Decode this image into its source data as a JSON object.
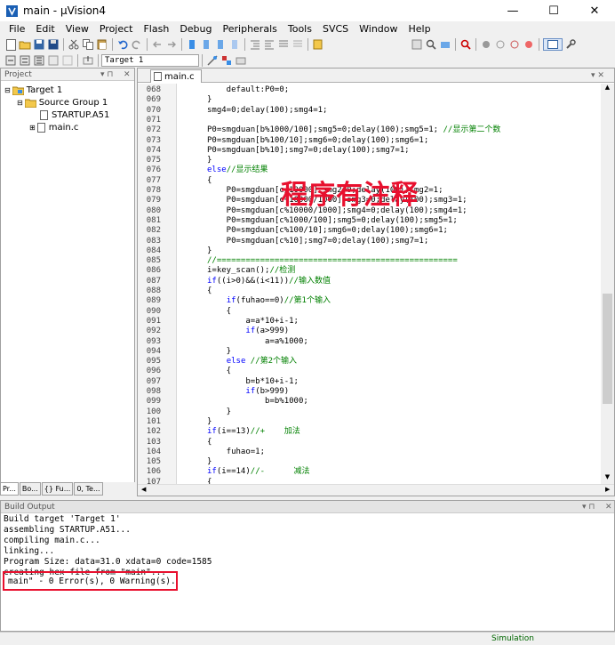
{
  "window": {
    "title": "main - µVision4",
    "minimize": "—",
    "maximize": "☐",
    "close": "✕"
  },
  "menu": [
    {
      "label": "File",
      "u": "F",
      "rest": "ile"
    },
    {
      "label": "Edit",
      "u": "E",
      "rest": "dit"
    },
    {
      "label": "View",
      "u": "V",
      "rest": "iew"
    },
    {
      "label": "Project",
      "u": "P",
      "rest": "roject"
    },
    {
      "label": "Flash",
      "u": "l",
      "pre": "F",
      "rest": "ash"
    },
    {
      "label": "Debug",
      "u": "D",
      "rest": "ebug"
    },
    {
      "label": "Peripherals",
      "u": "k",
      "pre": "Peripherals",
      "rest": ""
    },
    {
      "label": "Tools",
      "u": "T",
      "rest": "ools"
    },
    {
      "label": "SVCS",
      "u": "S",
      "rest": "VCS"
    },
    {
      "label": "Window",
      "u": "W",
      "rest": "indow"
    },
    {
      "label": "Help",
      "u": "H",
      "rest": "elp"
    }
  ],
  "toolbar": {
    "target_select": "Target 1"
  },
  "project": {
    "header": "Project",
    "tree": {
      "target": "Target 1",
      "group": "Source Group 1",
      "file_asm": "STARTUP.A51",
      "file_c": "main.c"
    },
    "tabs": [
      "Pr...",
      "Bo...",
      "{} Fu...",
      "0, Te..."
    ]
  },
  "editor": {
    "tab": "main.c",
    "watermark": "程序有注释",
    "lines": [
      {
        "n": "068",
        "code": "    default:P0=0;"
      },
      {
        "n": "069",
        "code": "}"
      },
      {
        "n": "070",
        "code": "smg4=0;delay(100);smg4=1;"
      },
      {
        "n": "071",
        "code": ""
      },
      {
        "n": "072",
        "code": "P0=smgduan[b%1000/100];smg5=0;delay(100);smg5=1; ",
        "comment": "//显示第二个数"
      },
      {
        "n": "073",
        "code": "P0=smgduan[b%100/10];smg6=0;delay(100);smg6=1;"
      },
      {
        "n": "074",
        "code": "P0=smgduan[b%10];smg7=0;delay(100);smg7=1;"
      },
      {
        "n": "075",
        "code": "}"
      },
      {
        "n": "076",
        "kw": "else",
        "comment": "//显示结果"
      },
      {
        "n": "077",
        "code": "{"
      },
      {
        "n": "078",
        "code": "    P0=smgduan[c/10000];smg2=0;delay(100);smg2=1;"
      },
      {
        "n": "079",
        "code": "    P0=smgduan[c%10000/1000];smg3=0;delay(100);smg3=1;"
      },
      {
        "n": "080",
        "code": "    P0=smgduan[c%10000/1000];smg4=0;delay(100);smg4=1;"
      },
      {
        "n": "081",
        "code": "    P0=smgduan[c%1000/100];smg5=0;delay(100);smg5=1;"
      },
      {
        "n": "082",
        "code": "    P0=smgduan[c%100/10];smg6=0;delay(100);smg6=1;"
      },
      {
        "n": "083",
        "code": "    P0=smgduan[c%10];smg7=0;delay(100);smg7=1;"
      },
      {
        "n": "084",
        "code": "}"
      },
      {
        "n": "085",
        "comment": "//=================================================="
      },
      {
        "n": "086",
        "code": "i=key_scan();",
        "comment": "//检测"
      },
      {
        "n": "087",
        "kw": "if",
        "code": "((i>0)&&(i<11))",
        "comment": "//输入数值"
      },
      {
        "n": "088",
        "code": "{"
      },
      {
        "n": "089",
        "pre": "    ",
        "kw": "if",
        "code": "(fuhao==0)",
        "comment": "//第1个输入"
      },
      {
        "n": "090",
        "code": "    {"
      },
      {
        "n": "091",
        "code": "        a=a*10+i-1;"
      },
      {
        "n": "092",
        "pre": "        ",
        "kw": "if",
        "code": "(a>999)"
      },
      {
        "n": "093",
        "code": "            a=a%1000;"
      },
      {
        "n": "094",
        "code": "    }"
      },
      {
        "n": "095",
        "pre": "    ",
        "kw": "else",
        "code": " ",
        "comment": "//第2个输入"
      },
      {
        "n": "096",
        "code": "    {"
      },
      {
        "n": "097",
        "code": "        b=b*10+i-1;"
      },
      {
        "n": "098",
        "pre": "        ",
        "kw": "if",
        "code": "(b>999)"
      },
      {
        "n": "099",
        "code": "            b=b%1000;"
      },
      {
        "n": "100",
        "code": "    }"
      },
      {
        "n": "101",
        "code": "}"
      },
      {
        "n": "102",
        "kw": "if",
        "code": "(i==13)",
        "comment": "//+    加法"
      },
      {
        "n": "103",
        "code": "{"
      },
      {
        "n": "104",
        "code": "    fuhao=1;"
      },
      {
        "n": "105",
        "code": "}"
      },
      {
        "n": "106",
        "kw": "if",
        "code": "(i==14)",
        "comment": "//-      减法"
      },
      {
        "n": "107",
        "code": "{"
      }
    ]
  },
  "build": {
    "header": "Build Output",
    "lines": [
      "Build target 'Target 1'",
      "assembling STARTUP.A51...",
      "compiling main.c...",
      "linking...",
      "Program Size: data=31.0 xdata=0 code=1585",
      "creating hex file from \"main\"...",
      "main\" - 0 Error(s), 0 Warning(s)."
    ]
  },
  "status": {
    "mode": "Simulation"
  }
}
